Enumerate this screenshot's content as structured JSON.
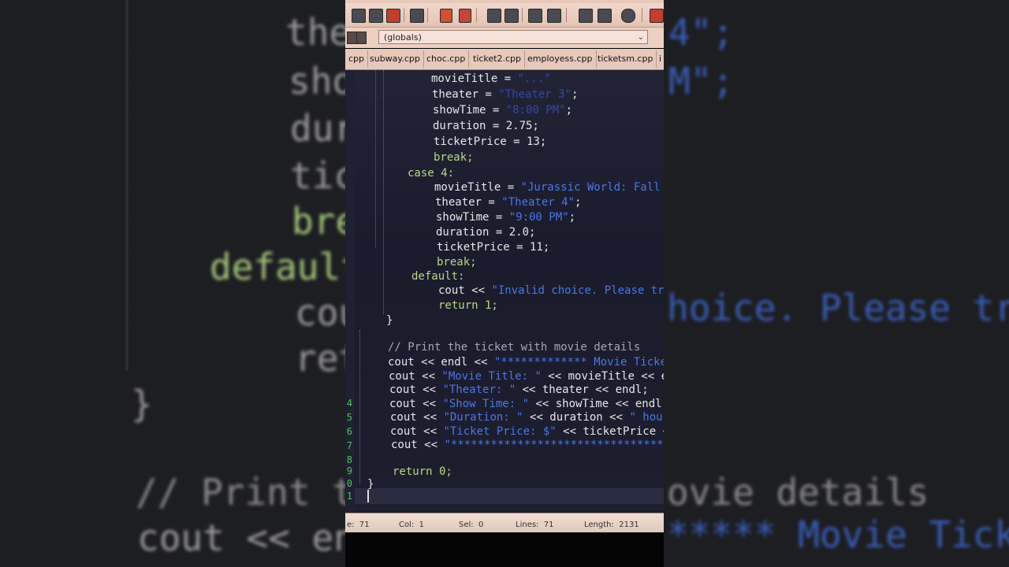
{
  "selector": {
    "value": "(globals)"
  },
  "tabs": [
    "cpp",
    "subway.cpp",
    "choc.cpp",
    "ticket2.cpp",
    "employess.cpp",
    "ticketsm.cpp",
    "i"
  ],
  "code": {
    "l1": {
      "a": "movieTitle = ",
      "b": "\"...\""
    },
    "l2": {
      "a": "theater = ",
      "b": "\"Theater 3\"",
      "c": ";"
    },
    "l3": {
      "a": "showTime = ",
      "b": "\"8:00 PM\"",
      "c": ";"
    },
    "l4": "duration = 2.75;",
    "l5": "ticketPrice = 13;",
    "l6": "break;",
    "l7": "case 4:",
    "l8": {
      "a": "movieTitle = ",
      "b": "\"Jurassic World: Fall"
    },
    "l9": {
      "a": "theater = ",
      "b": "\"Theater 4\"",
      "c": ";"
    },
    "l10": {
      "a": "showTime = ",
      "b": "\"9:00 PM\"",
      "c": ";"
    },
    "l11": "duration = 2.0;",
    "l12": "ticketPrice = 11;",
    "l13": "break;",
    "l14": "default:",
    "l15": {
      "a": "cout << ",
      "b": "\"Invalid choice. Please try"
    },
    "l16": "return 1;",
    "l17": "}",
    "l18": "// Print the ticket with movie details",
    "l19": {
      "a": "cout << endl << ",
      "b": "\"************* Movie Ticke"
    },
    "l20": {
      "a": "cout << ",
      "b": "\"Movie Title: \"",
      "c": " << movieTitle << en"
    },
    "l21": {
      "a": "cout << ",
      "b": "\"Theater: \"",
      "c": " << theater << endl;"
    },
    "l22": {
      "a": "cout << ",
      "b": "\"Show Time: \"",
      "c": " << showTime << endl;"
    },
    "l23": {
      "a": "cout << ",
      "b": "\"Duration: \"",
      "c": " << duration << ",
      "d": "\" hours"
    },
    "l24": {
      "a": "cout << ",
      "b": "\"Ticket Price: $\"",
      "c": " << ticketPrice <<"
    },
    "l25": {
      "a": "cout << ",
      "b": "\"*********************************"
    },
    "l26": "return 0;",
    "l27": "}"
  },
  "line_numbers": [
    "4",
    "5",
    "6",
    "7",
    "8",
    "9",
    "0",
    "1"
  ],
  "status": {
    "ln": "e:  71",
    "col": "Col:  1",
    "sel": "Sel:  0",
    "lines": "Lines:  71",
    "length": "Length:  2131"
  },
  "backdrop": {
    "b1": "the",
    "b2": "sho",
    "b3": "dur",
    "b4": "tic",
    "b5": "bre",
    "b6": "default",
    "b7": "cou",
    "b8": "ret",
    "b9": "}",
    "b10": "// Print t",
    "b11": "cout << en",
    "b12": "4\";",
    "b13": "M\";",
    "b14": "hoice. Please try",
    "b15": "ovie details",
    "b16": "***** Movie Ticke"
  }
}
